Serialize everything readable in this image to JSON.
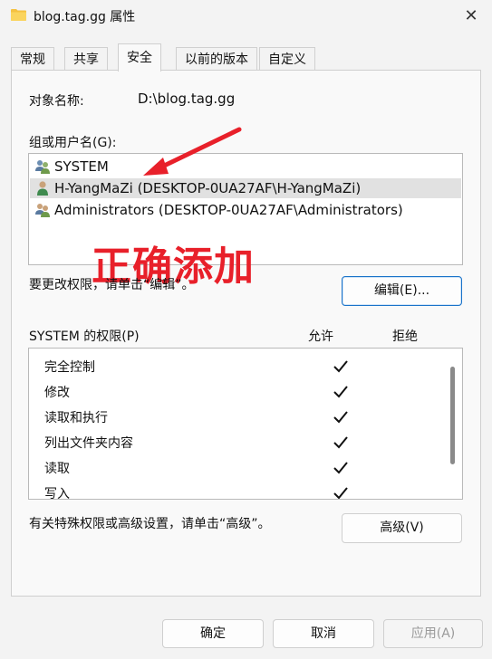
{
  "window": {
    "title": "blog.tag.gg 属性",
    "close_glyph": "✕"
  },
  "tabs": [
    {
      "label": "常规"
    },
    {
      "label": "共享"
    },
    {
      "label": "安全",
      "active": true
    },
    {
      "label": "以前的版本"
    },
    {
      "label": "自定义"
    }
  ],
  "security": {
    "object_name_label": "对象名称:",
    "object_name_value": "D:\\blog.tag.gg",
    "groups_label": "组或用户名(G):",
    "groups": [
      {
        "name": "SYSTEM",
        "icon": "group-users-icon"
      },
      {
        "name": "H-YangMaZi (DESKTOP-0UA27AF\\H-YangMaZi)",
        "icon": "user-icon",
        "selected": true
      },
      {
        "name": "Administrators (DESKTOP-0UA27AF\\Administrators)",
        "icon": "group-users-icon"
      }
    ],
    "annotation": "正确添加",
    "change_perm_text": "要更改权限，请单击“编辑”。",
    "edit_button": "编辑(E)...",
    "perm_header": "SYSTEM 的权限(P)",
    "allow_header": "允许",
    "deny_header": "拒绝",
    "permissions": [
      {
        "name": "完全控制",
        "allow": true,
        "deny": false
      },
      {
        "name": "修改",
        "allow": true,
        "deny": false
      },
      {
        "name": "读取和执行",
        "allow": true,
        "deny": false
      },
      {
        "name": "列出文件夹内容",
        "allow": true,
        "deny": false
      },
      {
        "name": "读取",
        "allow": true,
        "deny": false
      },
      {
        "name": "写入",
        "allow": true,
        "deny": false
      }
    ],
    "advanced_text": "有关特殊权限或高级设置，请单击“高级”。",
    "advanced_button": "高级(V)"
  },
  "footer": {
    "ok": "确定",
    "cancel": "取消",
    "apply": "应用(A)"
  },
  "colors": {
    "annotation": "#e8202a",
    "accent": "#1a73c9"
  }
}
